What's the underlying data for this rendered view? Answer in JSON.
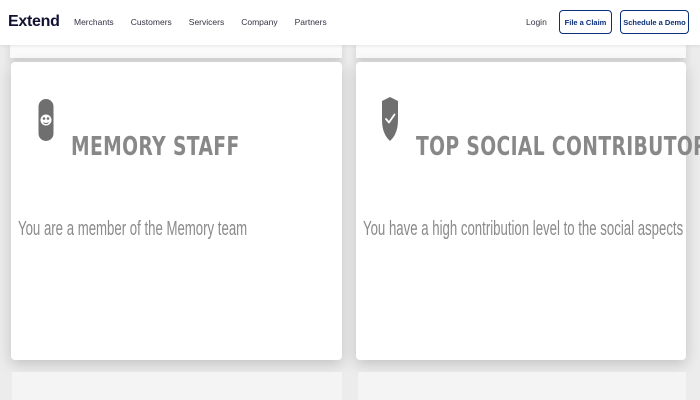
{
  "nav": {
    "logo": "Extend",
    "links": [
      "Merchants",
      "Customers",
      "Servicers",
      "Company",
      "Partners"
    ],
    "login": "Login",
    "file_claim": "File a Claim",
    "schedule_demo": "Schedule a Demo"
  },
  "cards": [
    {
      "title": "MEMORY STAFF",
      "description": "You are a member of the Memory team",
      "icon": "memory-badge-icon"
    },
    {
      "title": "TOP SOCIAL CONTRIBUTOR",
      "description": "You have a high contribution level to the social aspects",
      "icon": "shield-check-icon"
    }
  ],
  "colors": {
    "brand": "#0b2f7a",
    "title": "#888888",
    "icon": "#6f6f6f"
  }
}
